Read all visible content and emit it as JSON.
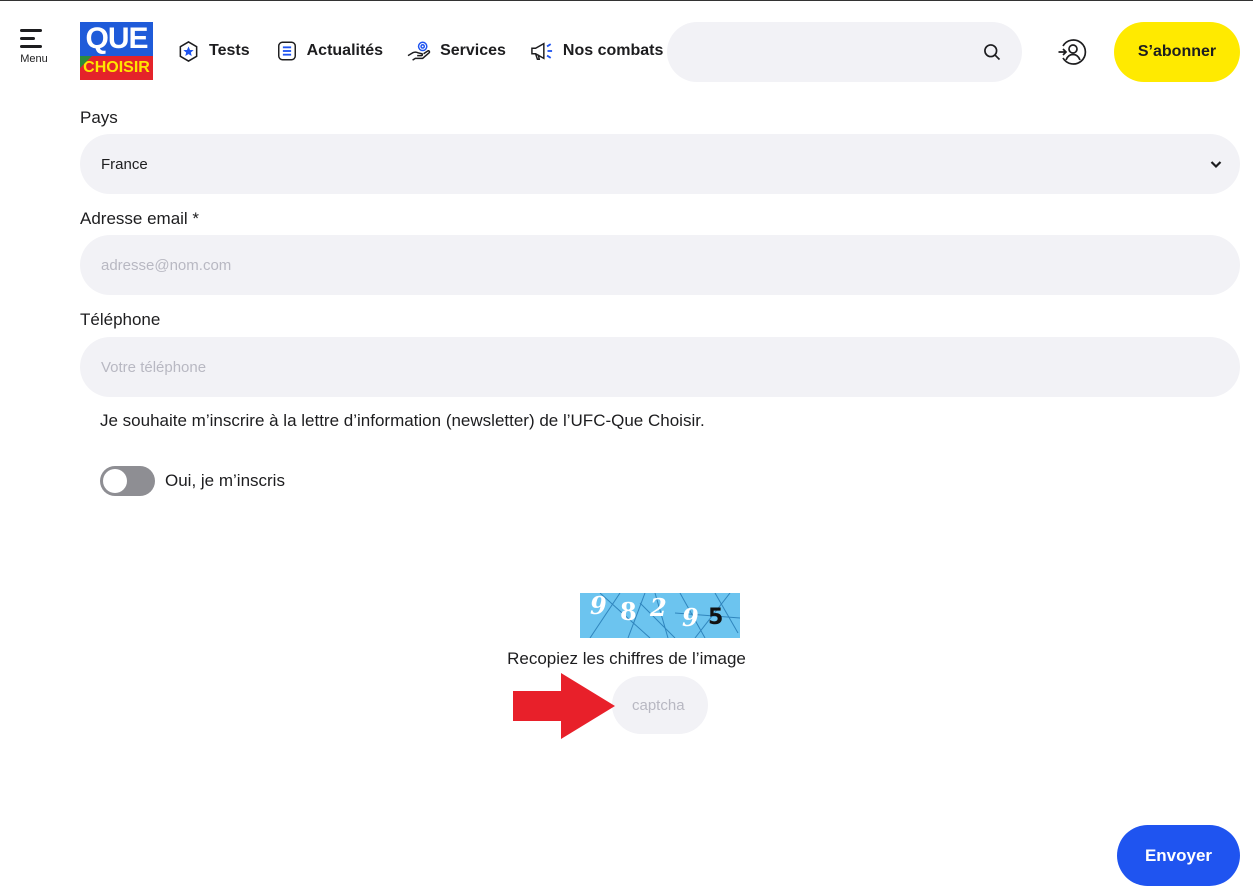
{
  "header": {
    "menu_label": "Menu",
    "logo_top": "QUE",
    "logo_bottom": "CHOISIR",
    "nav": [
      {
        "label": "Tests",
        "icon": "star-badge-icon"
      },
      {
        "label": "Actualités",
        "icon": "news-list-icon"
      },
      {
        "label": "Services",
        "icon": "helping-hand-icon"
      },
      {
        "label": "Nos combats",
        "icon": "megaphone-icon"
      }
    ],
    "search_placeholder": "",
    "subscribe_label": "S’abonner"
  },
  "form": {
    "country_label": "Pays",
    "country_value": "France",
    "email_label": "Adresse email *",
    "email_placeholder": "adresse@nom.com",
    "phone_label": "Téléphone",
    "phone_placeholder": "Votre téléphone",
    "newsletter_text": "Je souhaite m’inscrire à la lettre d’information (newsletter) de l’UFC-Que Choisir.",
    "newsletter_toggle_label": "Oui, je m’inscris",
    "newsletter_toggle_on": false,
    "captcha_digits": [
      "9",
      "8",
      "2",
      "9",
      "5"
    ],
    "captcha_caption": "Recopiez les chiffres de l’image",
    "captcha_placeholder": "captcha",
    "submit_label": "Envoyer"
  },
  "colors": {
    "accent_yellow": "#ffea00",
    "accent_blue": "#1f54f0",
    "field_bg": "#f2f2f6",
    "annotation_arrow": "#e8202a"
  }
}
